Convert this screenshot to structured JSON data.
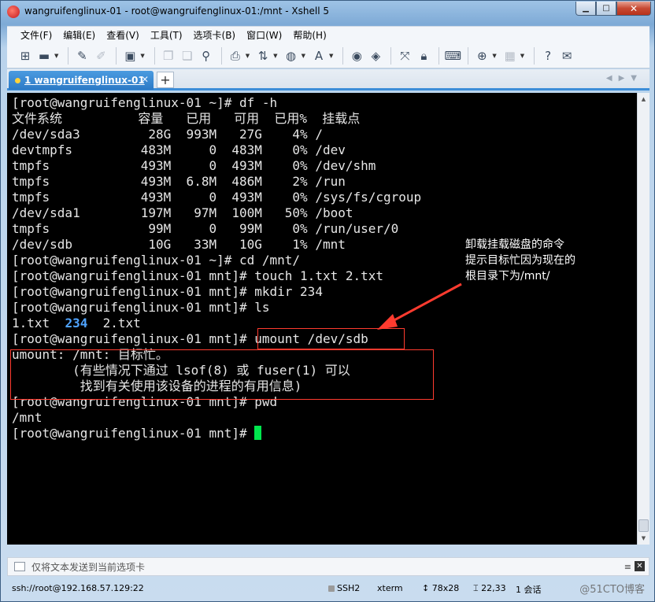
{
  "window": {
    "title": "wangruifenglinux-01 - root@wangruifenglinux-01:/mnt - Xshell 5",
    "min_glyph": "▁",
    "max_glyph": "□",
    "close_glyph": "✕"
  },
  "menu": [
    "文件(F)",
    "编辑(E)",
    "查看(V)",
    "工具(T)",
    "选项卡(B)",
    "窗口(W)",
    "帮助(H)"
  ],
  "toolbar_icons": [
    "new-session-icon",
    "open-folder-icon",
    "reconnect-icon",
    "disconnect-icon",
    "properties-icon",
    "copy-icon",
    "paste-icon",
    "find-icon",
    "print-icon",
    "transfer-icon",
    "globe-icon",
    "font-icon",
    "xftp-icon",
    "xmanager-icon",
    "fullscreen-icon",
    "lock-icon",
    "keyboard-icon",
    "add-tab-icon",
    "layout-icon",
    "help-icon",
    "chat-icon"
  ],
  "tab": {
    "index": "1",
    "label": "wangruifenglinux-01",
    "close": "✕",
    "add": "+"
  },
  "terminal": {
    "lines": [
      "[root@wangruifenglinux-01 ~]# df -h",
      "文件系统          容量   已用   可用  已用%  挂载点",
      "/dev/sda3         28G  993M   27G    4% /",
      "devtmpfs         483M     0  483M    0% /dev",
      "tmpfs            493M     0  493M    0% /dev/shm",
      "tmpfs            493M  6.8M  486M    2% /run",
      "tmpfs            493M     0  493M    0% /sys/fs/cgroup",
      "/dev/sda1        197M   97M  100M   50% /boot",
      "tmpfs             99M     0   99M    0% /run/user/0",
      "/dev/sdb          10G   33M   10G    1% /mnt",
      "[root@wangruifenglinux-01 ~]# cd /mnt/",
      "[root@wangruifenglinux-01 mnt]# touch 1.txt 2.txt",
      "[root@wangruifenglinux-01 mnt]# mkdir 234",
      "[root@wangruifenglinux-01 mnt]# ls"
    ],
    "ls_output": {
      "file1": "1.txt",
      "dir": "234",
      "file2": "2.txt"
    },
    "prompt_mnt": "[root@wangruifenglinux-01 mnt]# ",
    "umount_cmd": "umount /dev/sdb",
    "error_lines": [
      "umount: /mnt: 目标忙。",
      "        (有些情况下通过 lsof(8) 或 fuser(1) 可以",
      "         找到有关使用该设备的进程的有用信息)"
    ],
    "pwd_cmd": "pwd",
    "pwd_output": "/mnt"
  },
  "annotation": {
    "lines": [
      "卸载挂载磁盘的命令",
      "提示目标忙因为现在的",
      "根目录下为/mnt/"
    ],
    "color": "#ff3b2f"
  },
  "compose": {
    "placeholder": "仅将文本发送到当前选项卡"
  },
  "status": {
    "connection": "ssh://root@192.168.57.129:22",
    "protocol": "SSH2",
    "term": "xterm",
    "size": "78x28",
    "position": "22,33",
    "sessions": "1 会话"
  },
  "watermark": "@51CTO博客"
}
